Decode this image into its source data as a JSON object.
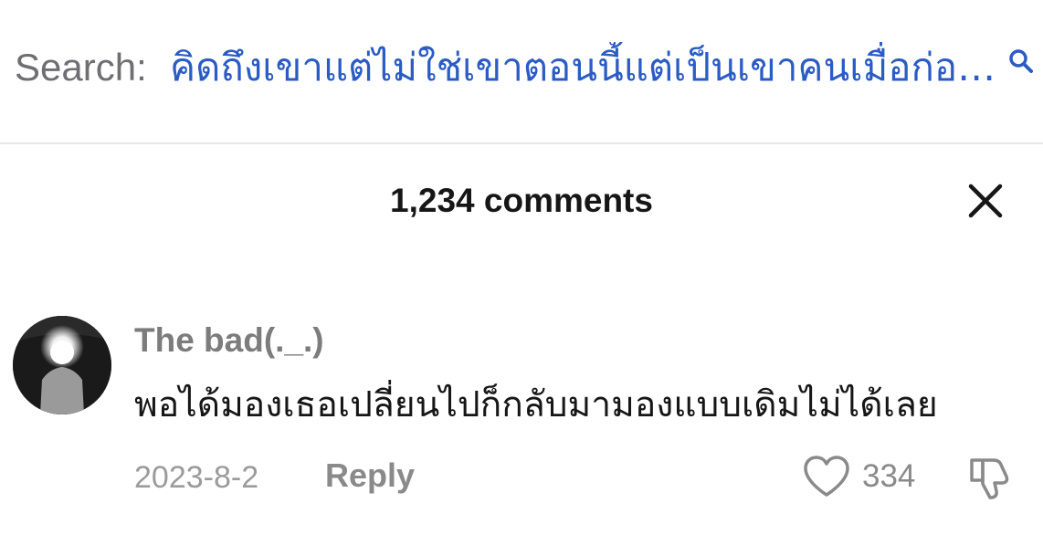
{
  "search": {
    "prefix": "Search:",
    "query": "คิดถึงเขาแต่ไม่ใช่เขาตอนนี้แต่เป็นเขาคนเมื่อก่อ…",
    "icon": "search-icon"
  },
  "comments_panel": {
    "title": "1,234 comments",
    "close_icon": "close-icon"
  },
  "comment": {
    "username": "The bad(._.)",
    "text": "พอได้มองเธอเปลี่ยนไปก็กลับมามองแบบเดิมไม่ได้เลย",
    "date": "2023-8-2",
    "reply_label": "Reply",
    "like_count": "334",
    "like_icon": "heart-outline-icon",
    "dislike_icon": "thumbs-down-icon"
  },
  "colors": {
    "query_blue": "#2b5cc4",
    "prefix_gray": "#6e6e73",
    "text_dark": "#161616",
    "meta_gray": "#9b9b9b",
    "divider": "#e6e6e6"
  }
}
